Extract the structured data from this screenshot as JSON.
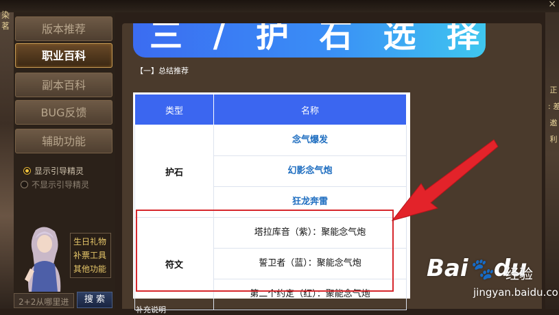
{
  "window": {
    "close_symbol": "×"
  },
  "backdrop": {
    "left_glyphs": "染\n茗",
    "right_glyphs": "正\n: 差\n邀\n利"
  },
  "sidebar": {
    "nav": [
      {
        "label": "版本推荐",
        "active": false
      },
      {
        "label": "职业百科",
        "active": true
      },
      {
        "label": "副本百科",
        "active": false
      },
      {
        "label": "BUG反馈",
        "active": false
      },
      {
        "label": "辅助功能",
        "active": false
      }
    ],
    "radio_show": "显示引导精灵",
    "radio_hide": "不显示引导精灵",
    "links": [
      "生日礼物",
      "补票工具",
      "其他功能"
    ],
    "search_placeholder": "2+2从哪里进",
    "search_button": "搜 索"
  },
  "main": {
    "banner_title": "三 / 护 石 选 择",
    "section_title": "【一】总结推荐",
    "table": {
      "headers": [
        "类型",
        "名称"
      ],
      "groups": [
        {
          "type": "护石",
          "items": [
            "念气爆发",
            "幻影念气炮",
            "狂龙奔雷"
          ]
        },
        {
          "type": "符文",
          "items": [
            "塔拉库音（紫）：聚能念气炮",
            "誓卫者（蓝）：聚能念气炮",
            "第二个约定（红）：聚能念气炮"
          ]
        }
      ]
    },
    "next_section": "补充说明"
  },
  "watermark": {
    "logo": "Bai",
    "logo_suffix": "du",
    "cn": "经验",
    "url": "jingyan.baidu.com"
  },
  "colors": {
    "banner_start": "#3b6cf1",
    "banner_end": "#3fc7ef",
    "table_header": "#3b66f0",
    "item_blue": "#1f6ec0",
    "highlight_red": "#d6262b"
  }
}
